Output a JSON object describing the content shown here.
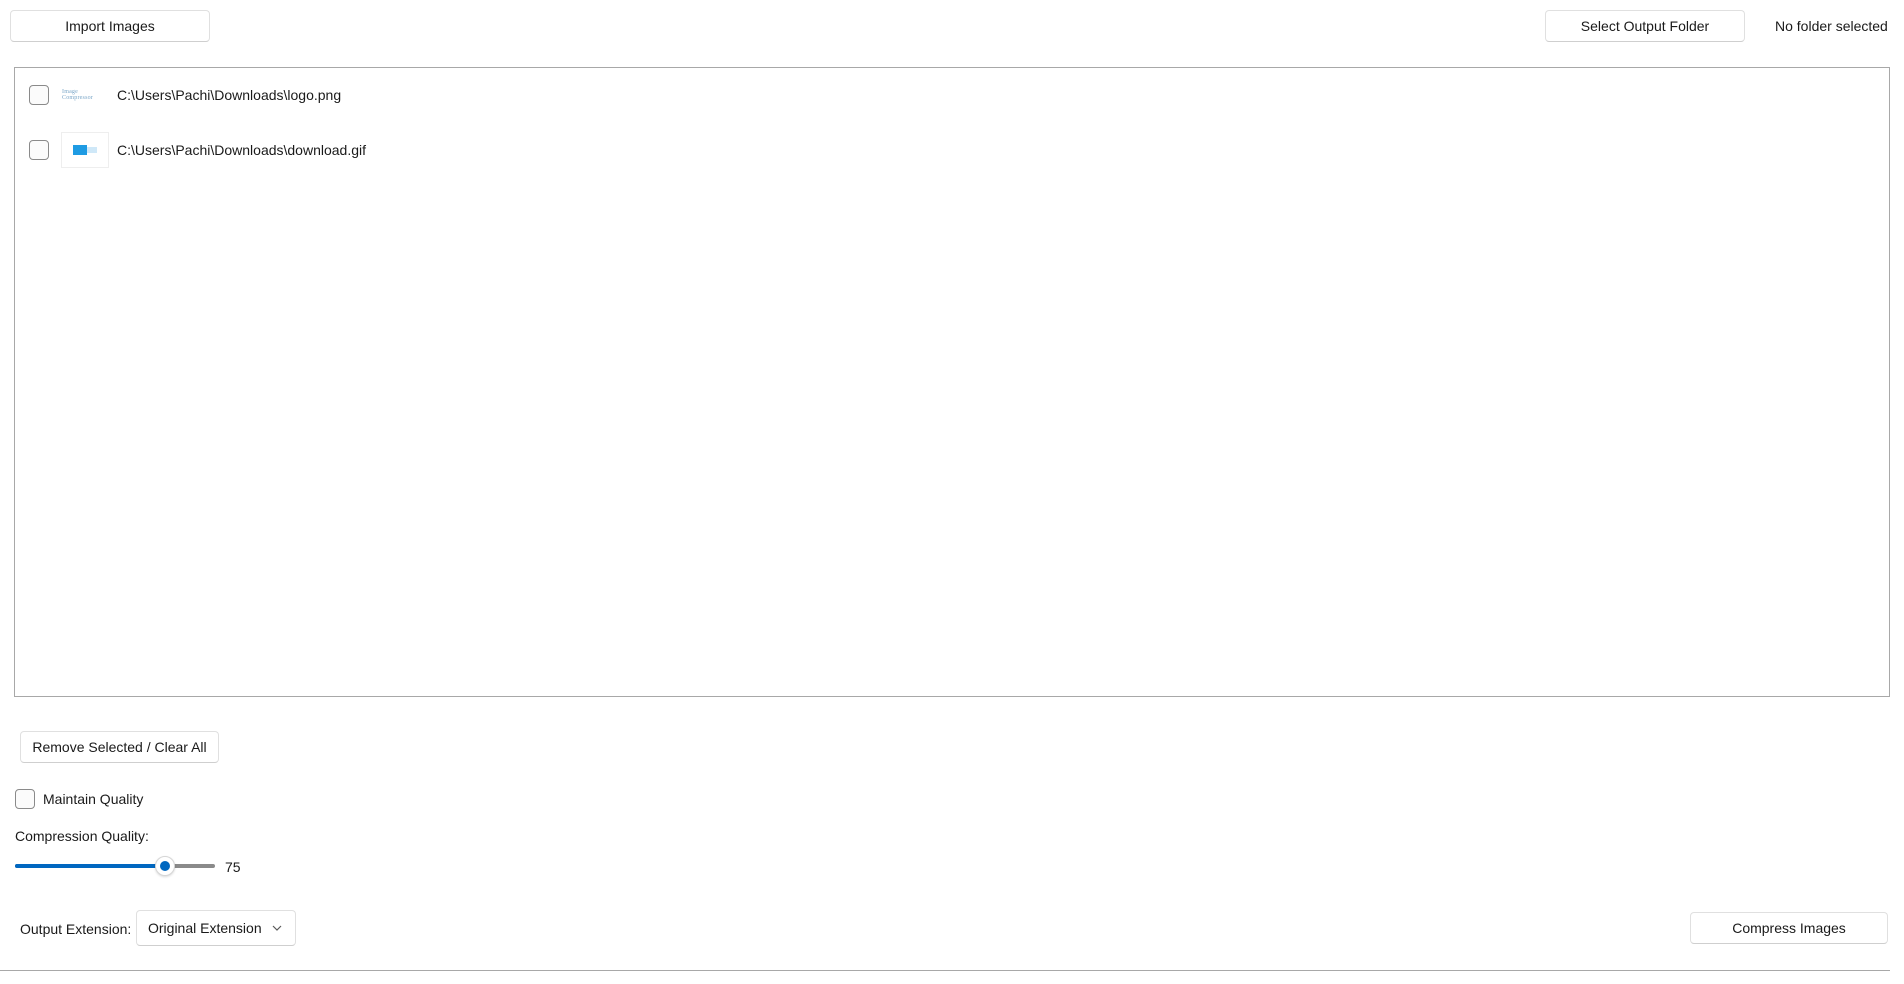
{
  "toolbar": {
    "import_label": "Import Images",
    "select_output_label": "Select Output Folder",
    "folder_status": "No folder selected"
  },
  "files": [
    {
      "path": "C:\\Users\\Pachi\\Downloads\\logo.png",
      "thumb": "logo-thumbnail",
      "thumb_text": "Image Compressor",
      "checked": false
    },
    {
      "path": "C:\\Users\\Pachi\\Downloads\\download.gif",
      "thumb": "gif-thumbnail",
      "checked": false
    }
  ],
  "actions": {
    "remove_label": "Remove Selected / Clear All"
  },
  "options": {
    "maintain_quality_label": "Maintain Quality",
    "maintain_quality_checked": false,
    "compression_quality_label": "Compression Quality:",
    "compression_quality_value": "75",
    "compression_quality_min": 0,
    "compression_quality_max": 100,
    "output_extension_label": "Output Extension:",
    "output_extension_value": "Original Extension"
  },
  "compress_label": "Compress Images",
  "colors": {
    "accent": "#0067c0",
    "border": "#a8a8a8"
  }
}
